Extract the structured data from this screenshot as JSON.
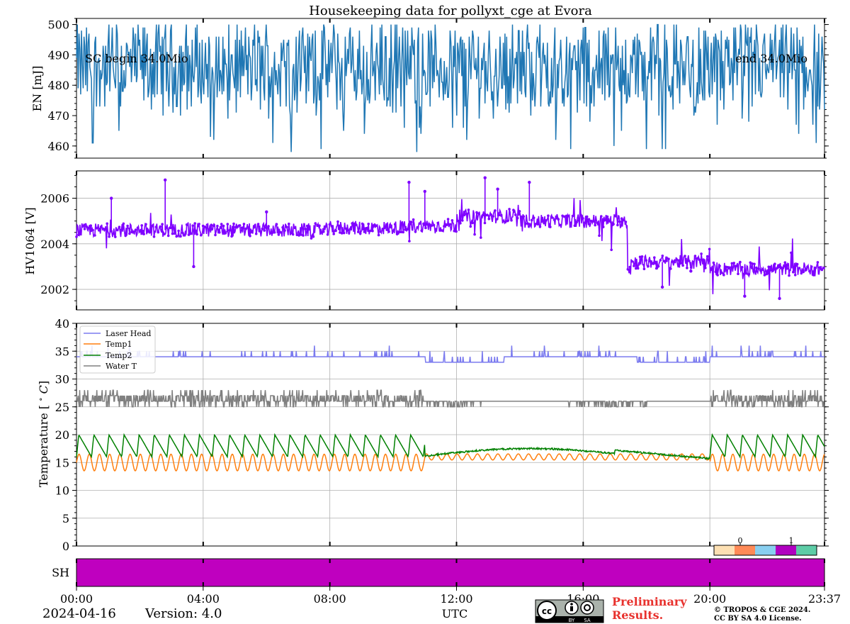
{
  "title": "Housekeeping data for pollyxt_cge at Evora",
  "footer": {
    "date": "2024-04-16",
    "version": "Version: 4.0",
    "xlabel": "UTC",
    "preliminary_line1": "Preliminary",
    "preliminary_line2": "Results.",
    "copyright_line1": "© TROPOS & CGE 2024.",
    "copyright_line2": "CC BY SA 4.0 License.",
    "license_badge": [
      "BY",
      "SA"
    ]
  },
  "colors": {
    "energy": "#1f77b4",
    "hv": "#7f00ff",
    "laser_head": "#7b7bef",
    "temp1": "#ff7f0e",
    "temp2": "#008000",
    "water": "#808080",
    "shutter": "#bf00bf",
    "prelim": "#e8322e"
  },
  "chart_data": [
    {
      "type": "line",
      "name": "energy",
      "ylabel": "EN [mJ]",
      "ylim": [
        456,
        502
      ],
      "yticks": [
        460,
        470,
        480,
        490,
        500
      ],
      "xlim_hours": [
        0,
        23.62
      ],
      "grid": false,
      "annotations": [
        "SC begin 34.0Mio",
        "end 34.0Mio"
      ],
      "summary": {
        "min": 458,
        "max": 500,
        "typical_range": [
          472,
          500
        ],
        "points": 900
      }
    },
    {
      "type": "line",
      "name": "hv1064",
      "ylabel": "HV1064 [V]",
      "ylim": [
        2001.1,
        2007.2
      ],
      "yticks": [
        2002,
        2004,
        2006
      ],
      "grid": true,
      "segments": [
        {
          "x": [
            0,
            8.0
          ],
          "y": [
            2004.6,
            2004.6
          ]
        },
        {
          "x": [
            8.0,
            10.5
          ],
          "y": [
            2004.7,
            2004.7
          ]
        },
        {
          "x": [
            10.5,
            12.0
          ],
          "y": [
            2004.8,
            2004.8
          ]
        },
        {
          "x": [
            12.0,
            14.0
          ],
          "y": [
            2005.2,
            2005.2
          ]
        },
        {
          "x": [
            14.0,
            17.4
          ],
          "y": [
            2005.0,
            2005.0
          ]
        },
        {
          "x": [
            17.5,
            20.0
          ],
          "y": [
            2003.2,
            2003.2
          ]
        },
        {
          "x": [
            20.0,
            23.62
          ],
          "y": [
            2002.9,
            2002.9
          ]
        }
      ],
      "spikes": [
        {
          "x": 1.1,
          "y": 2006.0
        },
        {
          "x": 2.8,
          "y": 2006.8
        },
        {
          "x": 6.0,
          "y": 2005.4
        },
        {
          "x": 10.5,
          "y": 2006.7
        },
        {
          "x": 11.0,
          "y": 2006.3
        },
        {
          "x": 12.9,
          "y": 2006.9
        },
        {
          "x": 13.3,
          "y": 2006.4
        },
        {
          "x": 14.3,
          "y": 2006.7
        },
        {
          "x": 3.7,
          "y": 2003.0
        },
        {
          "x": 18.5,
          "y": 2002.1
        },
        {
          "x": 19.4,
          "y": 2002.8
        },
        {
          "x": 21.1,
          "y": 2001.7
        },
        {
          "x": 22.2,
          "y": 2001.6
        }
      ]
    },
    {
      "type": "line",
      "name": "temperature",
      "ylabel": "Temperature [$^\\circ C$]",
      "ylim": [
        0,
        40
      ],
      "yticks": [
        0,
        5,
        10,
        15,
        20,
        25,
        30,
        35,
        40
      ],
      "grid": true,
      "legend": "top-left",
      "series": [
        {
          "name": "Laser Head",
          "values_by_period": {
            "00:00-11:00": 34,
            "11:00-20:00": 33,
            "20:00-23:37": 34
          }
        },
        {
          "name": "Temp1",
          "values_by_period": {
            "00:00-10:30": [
              13.5,
              16.5
            ],
            "10:30-20:00": [
              15.3,
              16.8
            ],
            "20:00-23:37": [
              14.0,
              16.5
            ]
          }
        },
        {
          "name": "Temp2",
          "values_by_period": {
            "00:00-11:00": [
              15,
              20
            ],
            "11:00-17:00": [
              16,
              17.5
            ],
            "17:00-20:00": [
              15.5,
              16.5
            ],
            "20:00-23:37": [
              15,
              20
            ]
          }
        },
        {
          "name": "Water T",
          "values_by_period": {
            "00:00-11:00": [
              25,
              28
            ],
            "11:00-20:00": [
              25,
              26
            ],
            "20:00-23:37": [
              25,
              28
            ]
          }
        }
      ],
      "colorbar": {
        "ticks": [
          "0",
          "1"
        ],
        "colors": [
          "#fde0b3",
          "#ff8a57",
          "#89cff0",
          "#b000c0",
          "#5dcca6"
        ]
      }
    },
    {
      "type": "area",
      "name": "shutter",
      "ylabel": "SH",
      "x_ticks": [
        "00:00",
        "04:00",
        "08:00",
        "12:00",
        "16:00",
        "20:00",
        "23:37"
      ],
      "x_tick_hours": [
        0,
        4,
        8,
        12,
        16,
        20,
        23.62
      ],
      "state": "on for whole period"
    }
  ]
}
